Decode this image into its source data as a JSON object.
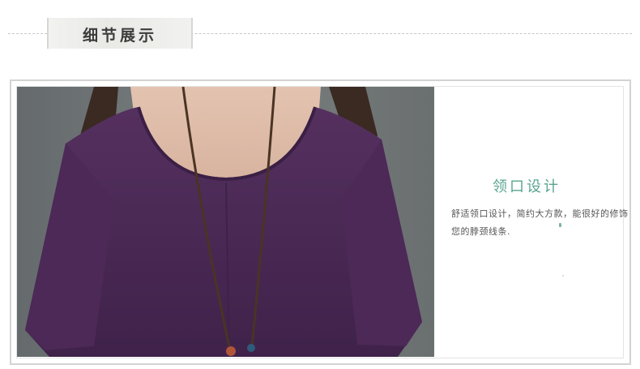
{
  "header": {
    "section_title": "细节展示"
  },
  "detail": {
    "title": "领口设计",
    "description": "舒适领口设计，简约大方款，能很好的修饰您的脖颈线条."
  },
  "photo": {
    "subject": "purple-linen-top-with-necklace",
    "garment_color": "#4a2a57",
    "background_color": "#6f7476"
  },
  "colors": {
    "accent": "#5aa48f",
    "frame_border": "#d3d3d3",
    "text": "#555555"
  }
}
